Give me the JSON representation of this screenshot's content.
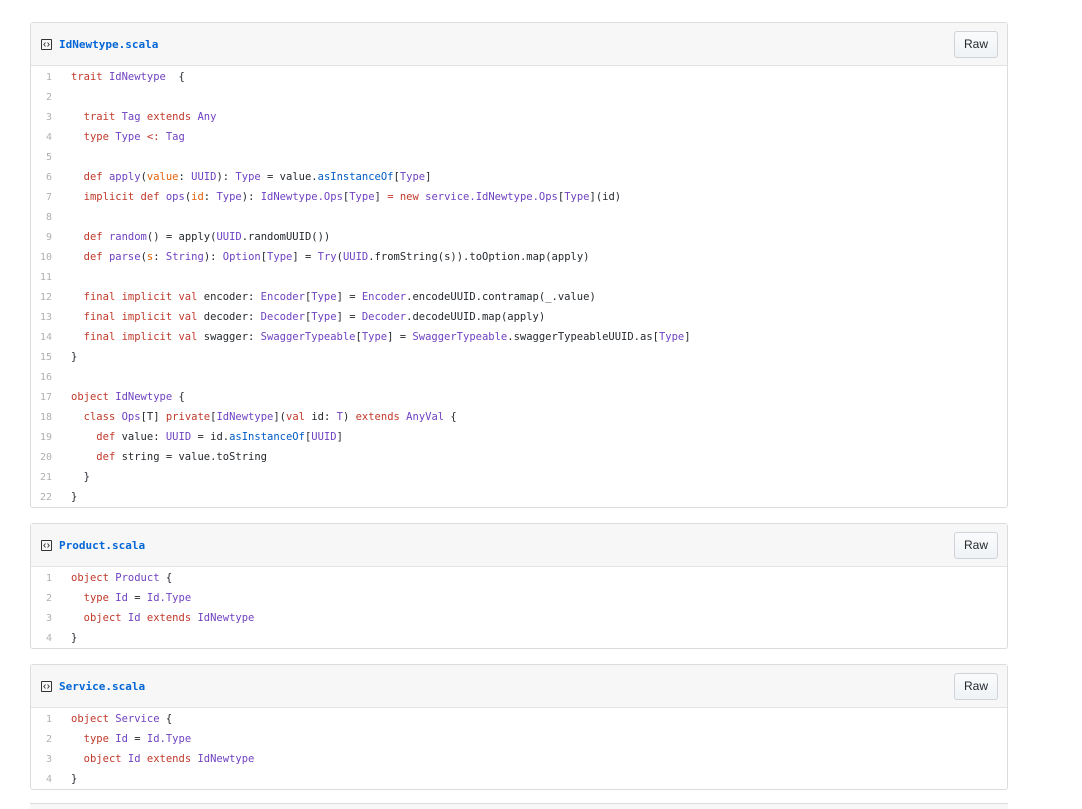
{
  "gists": [
    {
      "filename": "IdNewtype.scala",
      "raw_label": "Raw",
      "lines": [
        [
          [
            "k",
            "trait "
          ],
          [
            "t",
            "IdNewtype"
          ],
          [
            "",
            "  {"
          ]
        ],
        [],
        [
          [
            "",
            "  "
          ],
          [
            "k",
            "trait "
          ],
          [
            "t",
            "Tag "
          ],
          [
            "k",
            "extends "
          ],
          [
            "t",
            "Any"
          ]
        ],
        [
          [
            "",
            "  "
          ],
          [
            "k",
            "type "
          ],
          [
            "t",
            "Type "
          ],
          [
            "k",
            "<: "
          ],
          [
            "t",
            "Tag"
          ]
        ],
        [],
        [
          [
            "",
            "  "
          ],
          [
            "k",
            "def "
          ],
          [
            "t",
            "apply"
          ],
          [
            "",
            "("
          ],
          [
            "p",
            "value"
          ],
          [
            "",
            ": "
          ],
          [
            "t",
            "UUID"
          ],
          [
            "",
            "): "
          ],
          [
            "t",
            "Type"
          ],
          [
            "",
            " = value."
          ],
          [
            "s",
            "asInstanceOf"
          ],
          [
            "",
            "["
          ],
          [
            "t",
            "Type"
          ],
          [
            "",
            "]"
          ]
        ],
        [
          [
            "",
            "  "
          ],
          [
            "k",
            "implicit def "
          ],
          [
            "t",
            "ops"
          ],
          [
            "",
            "("
          ],
          [
            "p",
            "id"
          ],
          [
            "",
            ": "
          ],
          [
            "t",
            "Type"
          ],
          [
            "",
            "): "
          ],
          [
            "t",
            "IdNewtype.Ops"
          ],
          [
            "",
            "["
          ],
          [
            "t",
            "Type"
          ],
          [
            "",
            "] "
          ],
          [
            "k",
            "= new "
          ],
          [
            "t",
            "service.IdNewtype.Ops"
          ],
          [
            "",
            "["
          ],
          [
            "t",
            "Type"
          ],
          [
            "",
            "](id)"
          ]
        ],
        [],
        [
          [
            "",
            "  "
          ],
          [
            "k",
            "def "
          ],
          [
            "t",
            "random"
          ],
          [
            "",
            "() = apply("
          ],
          [
            "t",
            "UUID"
          ],
          [
            "",
            ".randomUUID())"
          ]
        ],
        [
          [
            "",
            "  "
          ],
          [
            "k",
            "def "
          ],
          [
            "t",
            "parse"
          ],
          [
            "",
            "("
          ],
          [
            "p",
            "s"
          ],
          [
            "",
            ": "
          ],
          [
            "t",
            "String"
          ],
          [
            "",
            "): "
          ],
          [
            "t",
            "Option"
          ],
          [
            "",
            "["
          ],
          [
            "t",
            "Type"
          ],
          [
            "",
            "] = "
          ],
          [
            "t",
            "Try"
          ],
          [
            "",
            "("
          ],
          [
            "t",
            "UUID"
          ],
          [
            "",
            ".fromString(s)).toOption.map(apply)"
          ]
        ],
        [],
        [
          [
            "",
            "  "
          ],
          [
            "k",
            "final implicit val "
          ],
          [
            "",
            "encoder: "
          ],
          [
            "t",
            "Encoder"
          ],
          [
            "",
            "["
          ],
          [
            "t",
            "Type"
          ],
          [
            "",
            "] = "
          ],
          [
            "t",
            "Encoder"
          ],
          [
            "",
            ".encodeUUID.contramap(_.value)"
          ]
        ],
        [
          [
            "",
            "  "
          ],
          [
            "k",
            "final implicit val "
          ],
          [
            "",
            "decoder: "
          ],
          [
            "t",
            "Decoder"
          ],
          [
            "",
            "["
          ],
          [
            "t",
            "Type"
          ],
          [
            "",
            "] = "
          ],
          [
            "t",
            "Decoder"
          ],
          [
            "",
            ".decodeUUID.map(apply)"
          ]
        ],
        [
          [
            "",
            "  "
          ],
          [
            "k",
            "final implicit val "
          ],
          [
            "",
            "swagger: "
          ],
          [
            "t",
            "SwaggerTypeable"
          ],
          [
            "",
            "["
          ],
          [
            "t",
            "Type"
          ],
          [
            "",
            "] = "
          ],
          [
            "t",
            "SwaggerTypeable"
          ],
          [
            "",
            ".swaggerTypeableUUID.as["
          ],
          [
            "t",
            "Type"
          ],
          [
            "",
            "]"
          ]
        ],
        [
          [
            "",
            "}"
          ]
        ],
        [],
        [
          [
            "k",
            "object "
          ],
          [
            "t",
            "IdNewtype"
          ],
          [
            "",
            " {"
          ]
        ],
        [
          [
            "",
            "  "
          ],
          [
            "k",
            "class "
          ],
          [
            "t",
            "Ops"
          ],
          [
            "",
            "[T] "
          ],
          [
            "k",
            "private"
          ],
          [
            "",
            "["
          ],
          [
            "t",
            "IdNewtype"
          ],
          [
            "",
            "]("
          ],
          [
            "k",
            "val "
          ],
          [
            "",
            "id: "
          ],
          [
            "t",
            "T"
          ],
          [
            "",
            ") "
          ],
          [
            "k",
            "extends "
          ],
          [
            "t",
            "AnyVal"
          ],
          [
            "",
            " {"
          ]
        ],
        [
          [
            "",
            "    "
          ],
          [
            "k",
            "def "
          ],
          [
            "",
            "value: "
          ],
          [
            "t",
            "UUID"
          ],
          [
            "",
            " = id."
          ],
          [
            "s",
            "asInstanceOf"
          ],
          [
            "",
            "["
          ],
          [
            "t",
            "UUID"
          ],
          [
            "",
            "]"
          ]
        ],
        [
          [
            "",
            "    "
          ],
          [
            "k",
            "def "
          ],
          [
            "",
            "string = value.toString"
          ]
        ],
        [
          [
            "",
            "  }"
          ]
        ],
        [
          [
            "",
            "}"
          ]
        ]
      ]
    },
    {
      "filename": "Product.scala",
      "raw_label": "Raw",
      "lines": [
        [
          [
            "k",
            "object "
          ],
          [
            "t",
            "Product"
          ],
          [
            "",
            " {"
          ]
        ],
        [
          [
            "",
            "  "
          ],
          [
            "k",
            "type "
          ],
          [
            "t",
            "Id"
          ],
          [
            "",
            " = "
          ],
          [
            "t",
            "Id.Type"
          ]
        ],
        [
          [
            "",
            "  "
          ],
          [
            "k",
            "object "
          ],
          [
            "t",
            "Id "
          ],
          [
            "k",
            "extends "
          ],
          [
            "t",
            "IdNewtype"
          ]
        ],
        [
          [
            "",
            "}"
          ]
        ]
      ]
    },
    {
      "filename": "Service.scala",
      "raw_label": "Raw",
      "lines": [
        [
          [
            "k",
            "object "
          ],
          [
            "t",
            "Service"
          ],
          [
            "",
            " {"
          ]
        ],
        [
          [
            "",
            "  "
          ],
          [
            "k",
            "type "
          ],
          [
            "t",
            "Id"
          ],
          [
            "",
            " = "
          ],
          [
            "t",
            "Id.Type"
          ]
        ],
        [
          [
            "",
            "  "
          ],
          [
            "k",
            "object "
          ],
          [
            "t",
            "Id "
          ],
          [
            "k",
            "extends "
          ],
          [
            "t",
            "IdNewtype"
          ]
        ],
        [
          [
            "",
            "}"
          ]
        ]
      ]
    }
  ]
}
